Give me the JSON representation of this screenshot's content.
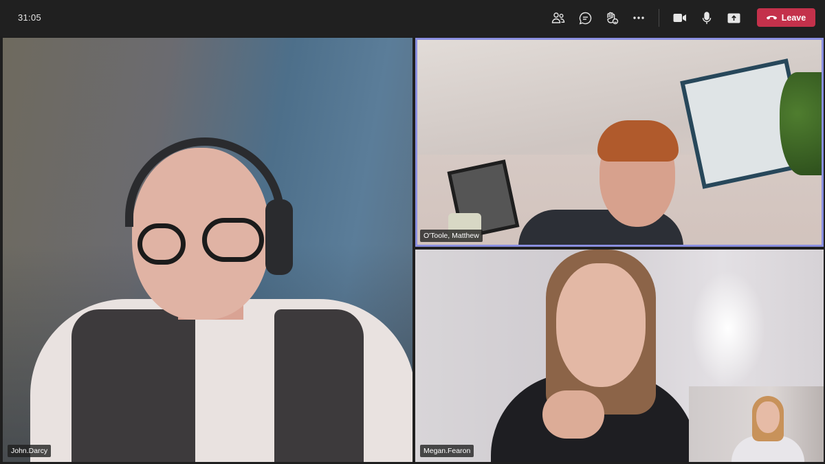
{
  "meeting": {
    "timer": "31:05",
    "leave_label": "Leave"
  },
  "toolbar": {
    "icons": [
      "participants-icon",
      "chat-icon",
      "raise-hand-icon",
      "more-options-icon",
      "camera-icon",
      "microphone-icon",
      "share-screen-icon",
      "phone-hangup-icon"
    ]
  },
  "participants": [
    {
      "name": "John.Darcy"
    },
    {
      "name": "O'Toole, Matthew"
    },
    {
      "name": "Megan.Fearon"
    }
  ],
  "colors": {
    "leave": "#c4314b",
    "active_speaker_border": "#8a8fe0",
    "background": "#1f1f1f"
  }
}
